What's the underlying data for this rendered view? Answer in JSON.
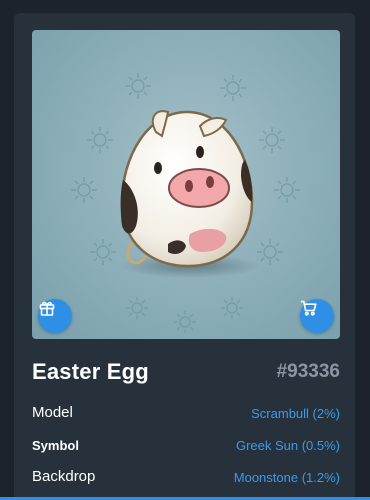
{
  "item": {
    "title": "Easter Egg",
    "serial": "#93336"
  },
  "attributes": [
    {
      "label": "Model",
      "value": "Scrambull (2%)"
    },
    {
      "label": "Symbol",
      "value": "Greek Sun (0.5%)"
    },
    {
      "label": "Backdrop",
      "value": "Moonstone (1.2%)"
    }
  ],
  "icons": {
    "gift": "gift-icon",
    "cart": "cart-icon"
  },
  "colors": {
    "accent": "#2d8fe6",
    "link": "#3b9ae8",
    "backdrop": "#8fb1bb",
    "card": "#27313c"
  }
}
